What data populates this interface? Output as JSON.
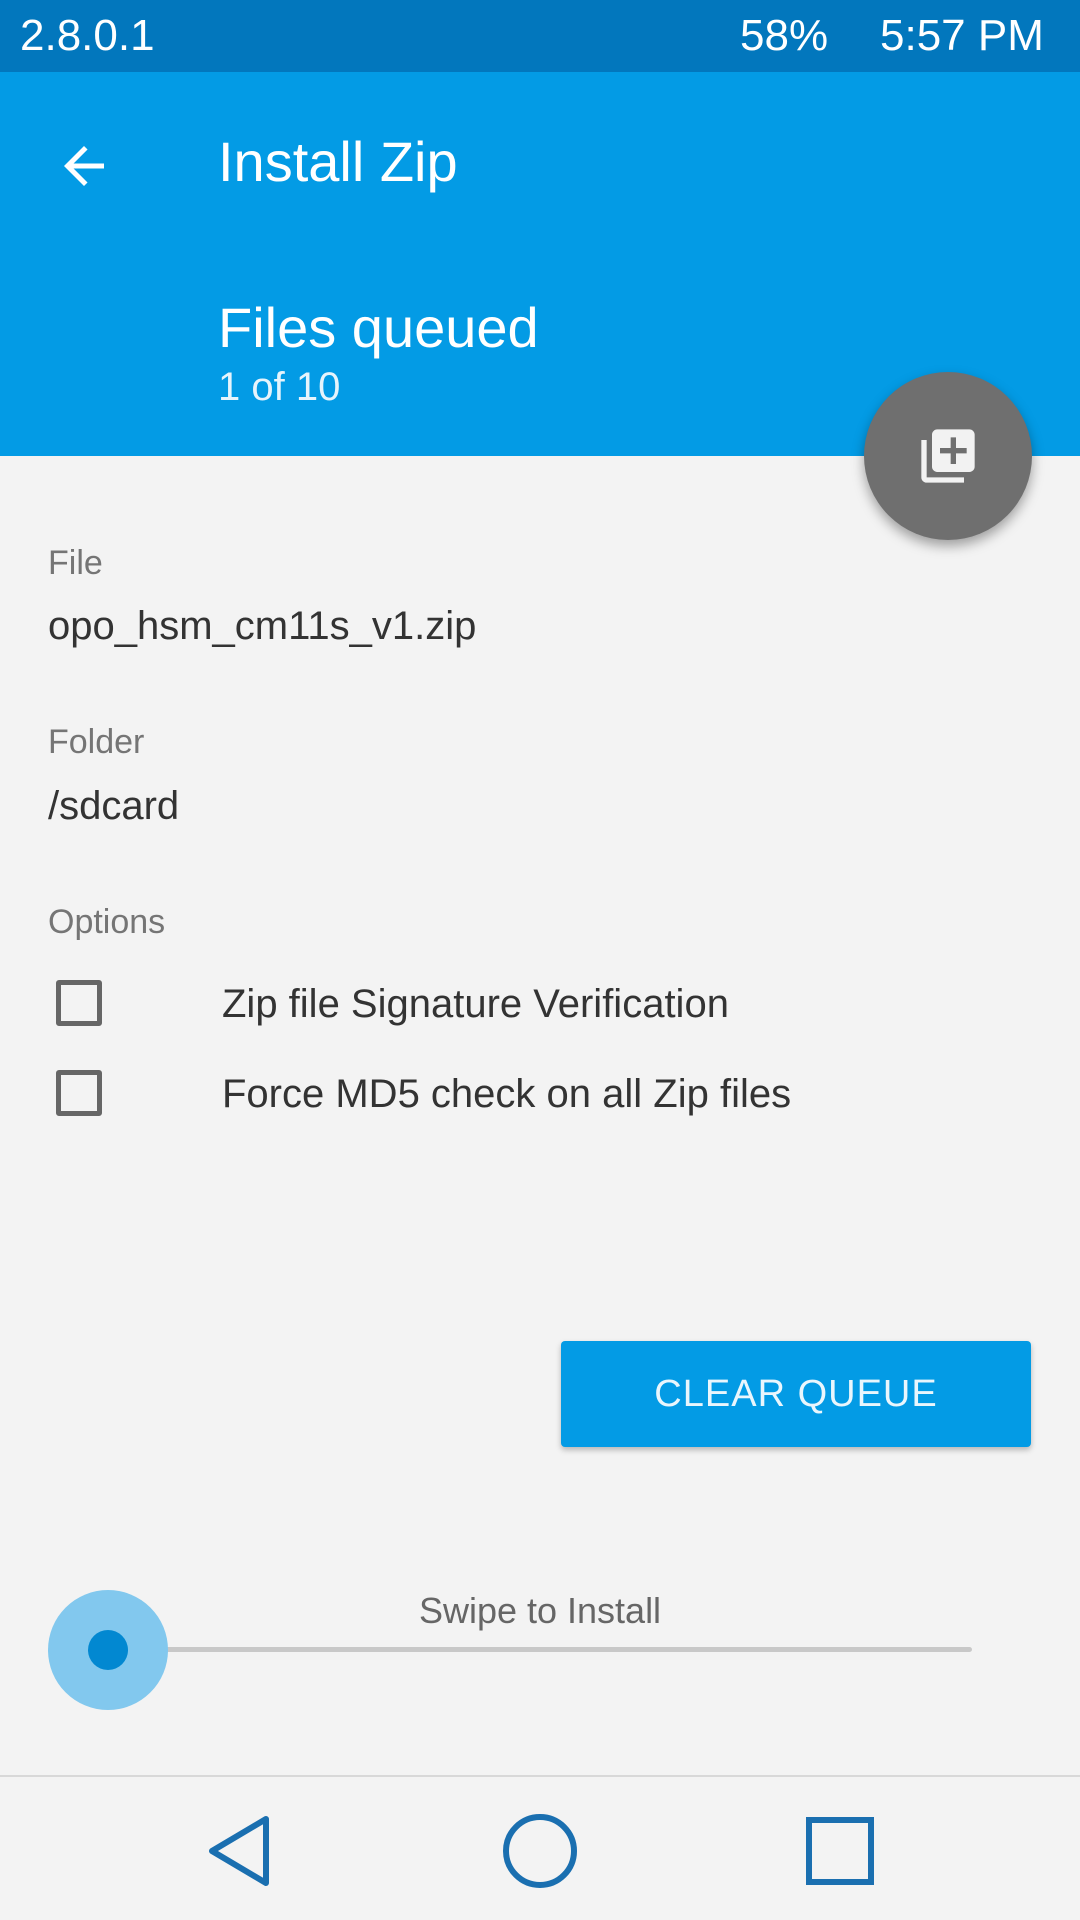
{
  "status_bar": {
    "version": "2.8.0.1",
    "battery": "58%",
    "time": "5:57 PM"
  },
  "header": {
    "title": "Install Zip",
    "queue_title": "Files queued",
    "queue_count": "1 of 10"
  },
  "fab": {
    "icon": "add-to-queue-icon"
  },
  "file": {
    "label": "File",
    "value": "opo_hsm_cm11s_v1.zip"
  },
  "folder": {
    "label": "Folder",
    "value": "/sdcard"
  },
  "options": {
    "label": "Options",
    "items": [
      {
        "label": "Zip file Signature Verification",
        "checked": false
      },
      {
        "label": "Force MD5 check on all Zip files",
        "checked": false
      }
    ]
  },
  "actions": {
    "clear_queue_label": "CLEAR QUEUE"
  },
  "swipe": {
    "label": "Swipe to Install",
    "progress": 0
  },
  "nav": {
    "back_icon": "back-triangle-icon",
    "home_icon": "home-circle-icon",
    "recents_icon": "recents-square-icon"
  },
  "colors": {
    "status_bar": "#0277bd",
    "header": "#039be5",
    "fab": "#6f6f6f",
    "background": "#f3f3f3",
    "accent": "#0288d1"
  }
}
